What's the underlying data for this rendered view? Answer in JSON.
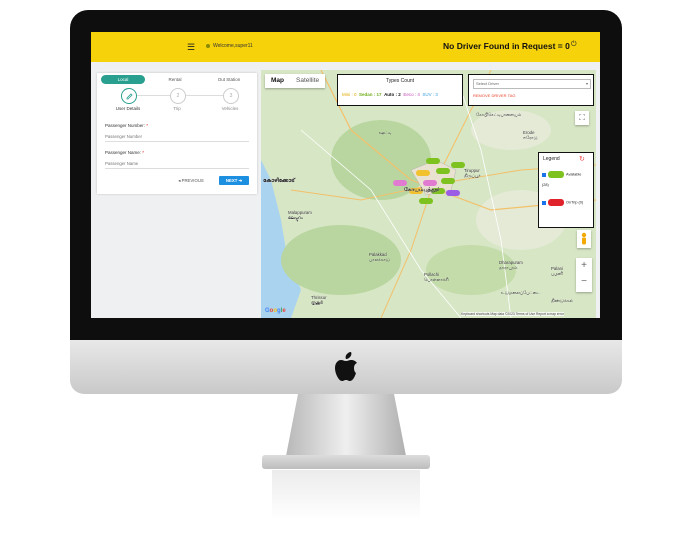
{
  "header": {
    "welcome": "Welcome,super11",
    "status": "No Driver Found in Request = 0"
  },
  "booking": {
    "tabs": [
      "Local",
      "Rental",
      "Out Station"
    ],
    "steps": [
      {
        "number": "",
        "label": "User Details"
      },
      {
        "number": "2",
        "label": "Trip"
      },
      {
        "number": "3",
        "label": "Vehicles"
      }
    ],
    "passenger_number_label": "Passenger Number:",
    "passenger_number_placeholder": "Passenger Number",
    "passenger_name_label": "Passenger Name:",
    "passenger_name_placeholder": "Passenger Name",
    "required_mark": "*",
    "previous_label": "PREVIOUS",
    "next_label": "NEXT"
  },
  "map": {
    "map_types": [
      "Map",
      "Satellite"
    ],
    "types_count": {
      "title": "Types Count",
      "mini": "Mini : 0",
      "sedan": "Sedan : 17",
      "auto": "Auto : 2",
      "eeco": "Eeco : 4",
      "suv": "SUV : 3"
    },
    "driver_select": "Select Driver",
    "remove_tag": "REMOVE DRIVER TAG",
    "legend": {
      "title": "Legend",
      "available": "Available",
      "available_count": "(28)",
      "ontrip": "OnTrip (0)"
    },
    "cities": [
      {
        "name": "Coimbatore",
        "local": "கோயம்புத்தூர்"
      },
      {
        "name": "Tiruppur",
        "local": "திருப்பூர்"
      },
      {
        "name": "Erode",
        "local": "ஈரோடு"
      },
      {
        "name": "Palakkad",
        "local": "பாலக்காடு"
      },
      {
        "name": "Pollachi",
        "local": "பொள்ளாச்சி"
      },
      {
        "name": "Thrissur",
        "local": "തൃശൂർ"
      },
      {
        "name": "Malappuram",
        "local": "മലപ്പുറം"
      },
      {
        "name": "Dharapuram",
        "local": "தாராபுரம்"
      },
      {
        "name": "Palani",
        "local": "பழனி"
      },
      {
        "name": "Udumalaipettai",
        "local": "உடுமலைப்பேட்டை"
      },
      {
        "name": "Gobichettipalayam",
        "local": "கோபிசெட்டிபாளையம்"
      },
      {
        "name": "Kozhikode",
        "local": "കോഴിക്കോട്"
      },
      {
        "name": "Ooty",
        "local": "ஊட்டி"
      },
      {
        "name": "Dindigul",
        "local": "திண்டுக்கல்"
      }
    ],
    "attribution": "Keyboard shortcuts   Map data ©2023   Terms of Use   Report a map error",
    "colors": {
      "available": "#7dc21e",
      "ontrip": "#e0232a",
      "accent": "#29a08f",
      "topbar": "#f6d20a"
    }
  }
}
